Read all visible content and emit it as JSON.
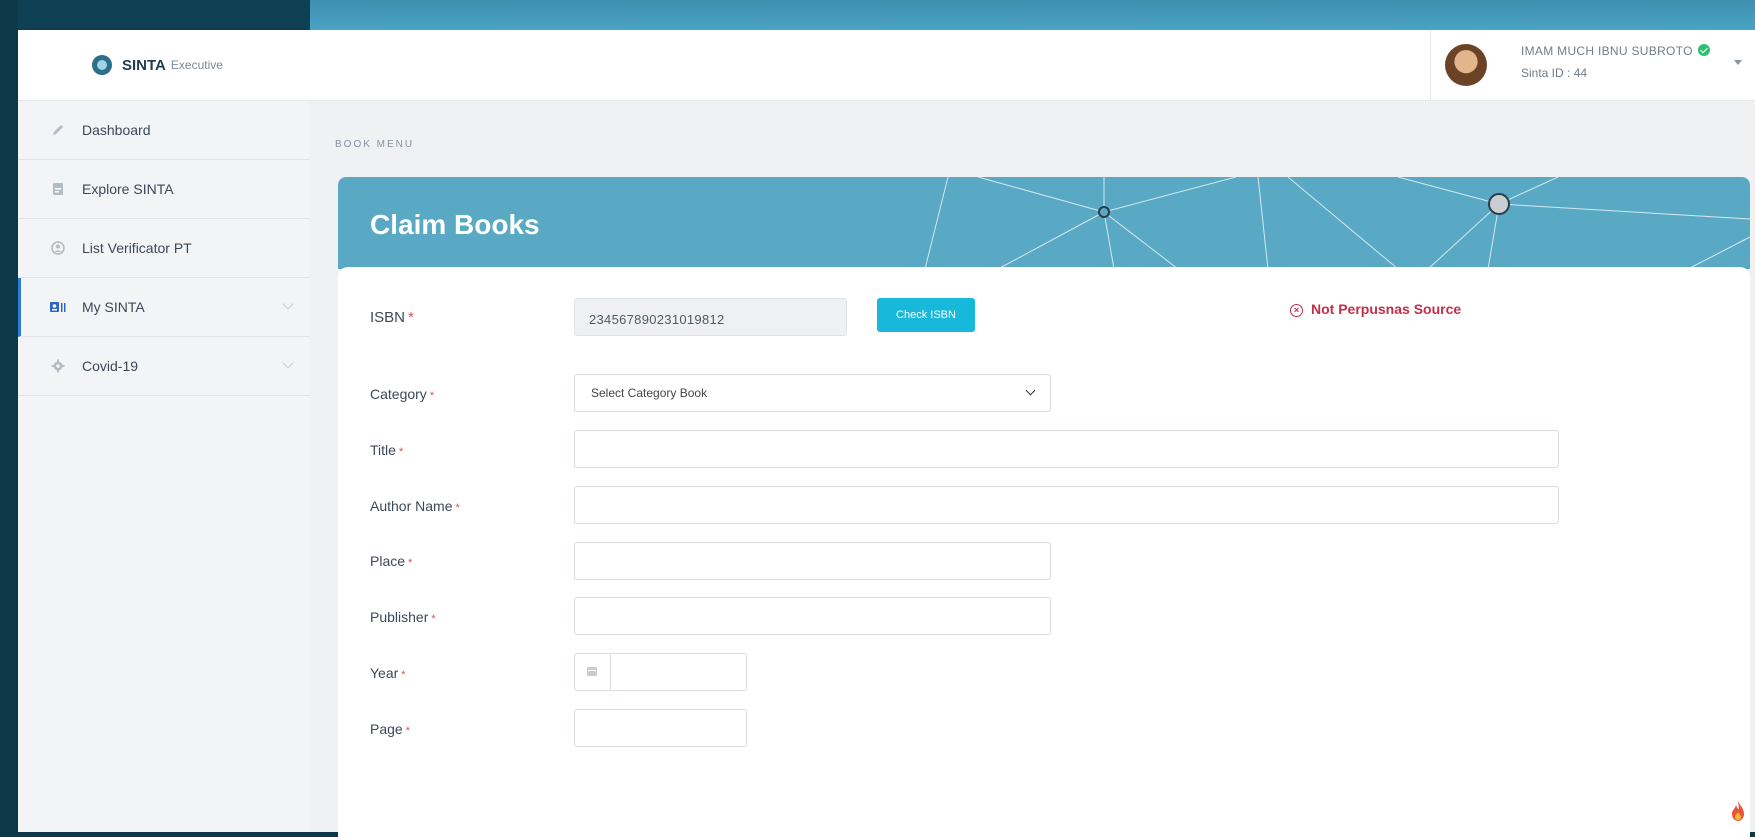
{
  "brand": {
    "name": "SINTA",
    "suffix": "Executive"
  },
  "sidebar": {
    "items": [
      {
        "label": "Dashboard",
        "icon": "pencil-icon"
      },
      {
        "label": "Explore SINTA",
        "icon": "document-icon"
      },
      {
        "label": "List Verificator PT",
        "icon": "user-circle-icon"
      },
      {
        "label": "My SINTA",
        "icon": "id-card-icon",
        "active": true
      },
      {
        "label": "Covid-19",
        "icon": "gear-icon"
      }
    ]
  },
  "user": {
    "name": "IMAM MUCH IBNU SUBROTO",
    "sinta_id": "Sinta ID : 44"
  },
  "breadcrumb": "BOOK MENU",
  "page": {
    "title": "Claim Books"
  },
  "form": {
    "isbn": {
      "label": "ISBN",
      "value": "234567890231019812"
    },
    "check_button": "Check ISBN",
    "source_status": "Not Perpusnas Source",
    "category": {
      "label": "Category",
      "selected": "Select Category Book"
    },
    "title": {
      "label": "Title",
      "value": ""
    },
    "author": {
      "label": "Author Name",
      "value": ""
    },
    "place": {
      "label": "Place",
      "value": ""
    },
    "publisher": {
      "label": "Publisher",
      "value": ""
    },
    "year": {
      "label": "Year",
      "value": ""
    },
    "page": {
      "label": "Page",
      "value": ""
    },
    "required_mark": "*"
  },
  "colors": {
    "banner": "#5aa9c4",
    "button": "#17b8d9",
    "error": "#c0304a",
    "active_nav": "#2e7ad6"
  }
}
